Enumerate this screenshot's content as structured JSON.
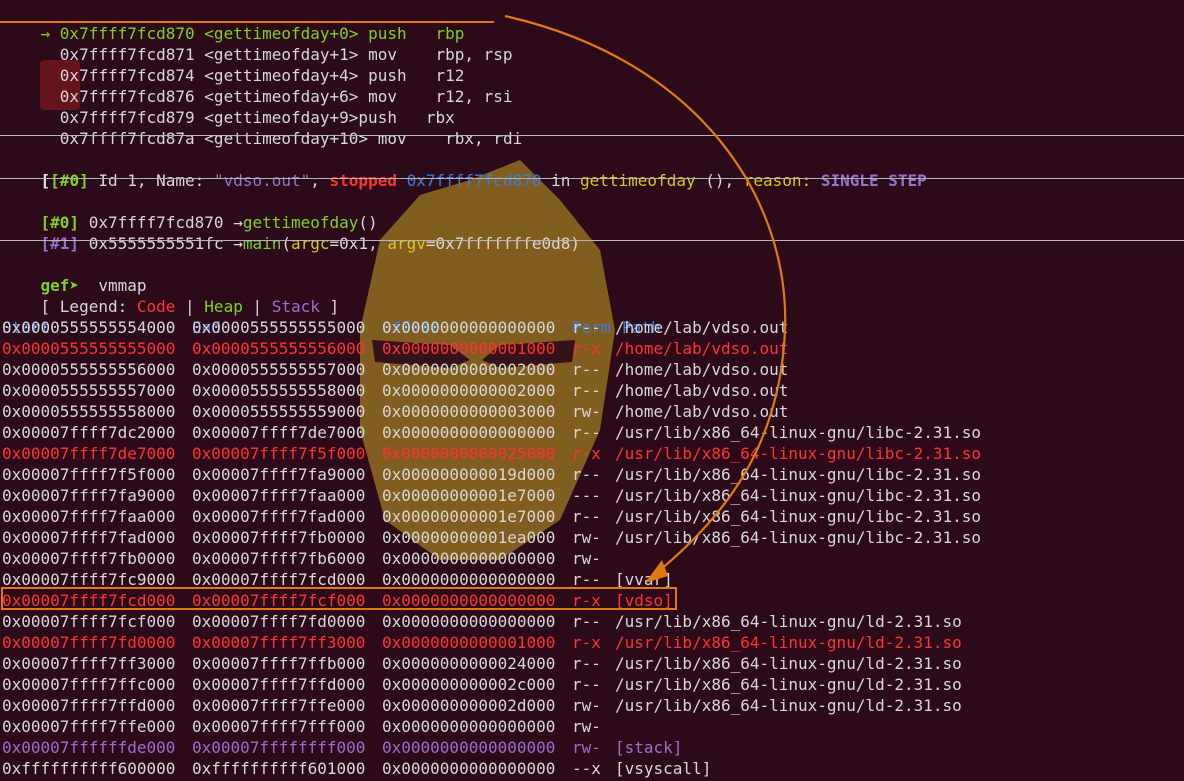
{
  "disasm": [
    {
      "arrow": "→ ",
      "addr": "0x7ffff7fcd870",
      "sym": "<gettimeofday+0>",
      "pad": " ",
      "mnem": "push",
      "gap": "   ",
      "ops": "rbp",
      "current": true
    },
    {
      "arrow": "  ",
      "addr": "0x7ffff7fcd871",
      "sym": "<gettimeofday+1>",
      "pad": " ",
      "mnem": "mov",
      "gap": "    ",
      "ops": "rbp, rsp",
      "current": false
    },
    {
      "arrow": "  ",
      "addr": "0x7ffff7fcd874",
      "sym": "<gettimeofday+4>",
      "pad": " ",
      "mnem": "push",
      "gap": "   ",
      "ops": "r12",
      "current": false
    },
    {
      "arrow": "  ",
      "addr": "0x7ffff7fcd876",
      "sym": "<gettimeofday+6>",
      "pad": " ",
      "mnem": "mov",
      "gap": "    ",
      "ops": "r12, rsi",
      "current": false
    },
    {
      "arrow": "  ",
      "addr": "0x7ffff7fcd879",
      "sym": "<gettimeofday+9>",
      "pad": "",
      "mnem": "push",
      "gap": "   ",
      "ops": "rbx",
      "current": false
    },
    {
      "arrow": "  ",
      "addr": "0x7ffff7fcd87a",
      "sym": "<gettimeofday+10>",
      "pad": " ",
      "mnem": "mov",
      "gap": "    ",
      "ops": "rbx, rdi",
      "current": false
    }
  ],
  "thread": {
    "index": "[#0]",
    "text1": " Id 1, Name: ",
    "name": "\"vdso.out\"",
    "comma": ", ",
    "stopped": "stopped",
    "addr": "0x7ffff7fcd870",
    "in": " in ",
    "func": "gettimeofday",
    "rest": " (), ",
    "reason_label": "reason:",
    "reason": "SINGLE STEP"
  },
  "trace": [
    {
      "index": "[#0]",
      "addr": " 0x7ffff7fcd870 ",
      "arrow": "→",
      "func": "gettimeofday",
      "args": "()"
    },
    {
      "index": "[#1]",
      "addr": " 0x5555555551fc ",
      "arrow": "→",
      "func": "main",
      "open": "(",
      "a1": "argc",
      "v1": "=0x1, ",
      "a2": "argv",
      "v2": "=0x7fffffffe0d8)"
    }
  ],
  "prompt": {
    "text": "gef➤",
    "command": "  vmmap"
  },
  "legend": {
    "open": "[ Legend: ",
    "code": "Code",
    "sep": " | ",
    "heap": "Heap",
    "stack": "Stack",
    "close": " ]"
  },
  "headers": {
    "start": "Start",
    "end": "End",
    "offset": "Offset",
    "perm": "Perm",
    "path": "Path"
  },
  "vmmap": [
    {
      "start": "0x0000555555554000",
      "end": "0x0000555555555000",
      "offset": "0x0000000000000000",
      "perm": "r--",
      "path": "/home/lab/vdso.out",
      "type": "normal"
    },
    {
      "start": "0x0000555555555000",
      "end": "0x0000555555556000",
      "offset": "0x0000000000001000",
      "perm": "r-x",
      "path": "/home/lab/vdso.out",
      "type": "code"
    },
    {
      "start": "0x0000555555556000",
      "end": "0x0000555555557000",
      "offset": "0x0000000000002000",
      "perm": "r--",
      "path": "/home/lab/vdso.out",
      "type": "normal"
    },
    {
      "start": "0x0000555555557000",
      "end": "0x0000555555558000",
      "offset": "0x0000000000002000",
      "perm": "r--",
      "path": "/home/lab/vdso.out",
      "type": "normal"
    },
    {
      "start": "0x0000555555558000",
      "end": "0x0000555555559000",
      "offset": "0x0000000000003000",
      "perm": "rw-",
      "path": "/home/lab/vdso.out",
      "type": "normal"
    },
    {
      "start": "0x00007ffff7dc2000",
      "end": "0x00007ffff7de7000",
      "offset": "0x0000000000000000",
      "perm": "r--",
      "path": "/usr/lib/x86_64-linux-gnu/libc-2.31.so",
      "type": "normal"
    },
    {
      "start": "0x00007ffff7de7000",
      "end": "0x00007ffff7f5f000",
      "offset": "0x0000000000025000",
      "perm": "r-x",
      "path": "/usr/lib/x86_64-linux-gnu/libc-2.31.so",
      "type": "code"
    },
    {
      "start": "0x00007ffff7f5f000",
      "end": "0x00007ffff7fa9000",
      "offset": "0x000000000019d000",
      "perm": "r--",
      "path": "/usr/lib/x86_64-linux-gnu/libc-2.31.so",
      "type": "normal"
    },
    {
      "start": "0x00007ffff7fa9000",
      "end": "0x00007ffff7faa000",
      "offset": "0x00000000001e7000",
      "perm": "---",
      "path": "/usr/lib/x86_64-linux-gnu/libc-2.31.so",
      "type": "normal"
    },
    {
      "start": "0x00007ffff7faa000",
      "end": "0x00007ffff7fad000",
      "offset": "0x00000000001e7000",
      "perm": "r--",
      "path": "/usr/lib/x86_64-linux-gnu/libc-2.31.so",
      "type": "normal"
    },
    {
      "start": "0x00007ffff7fad000",
      "end": "0x00007ffff7fb0000",
      "offset": "0x00000000001ea000",
      "perm": "rw-",
      "path": "/usr/lib/x86_64-linux-gnu/libc-2.31.so",
      "type": "normal"
    },
    {
      "start": "0x00007ffff7fb0000",
      "end": "0x00007ffff7fb6000",
      "offset": "0x0000000000000000",
      "perm": "rw-",
      "path": "",
      "type": "normal"
    },
    {
      "start": "0x00007ffff7fc9000",
      "end": "0x00007ffff7fcd000",
      "offset": "0x0000000000000000",
      "perm": "r--",
      "path": "[vvar]",
      "type": "normal"
    },
    {
      "start": "0x00007ffff7fcd000",
      "end": "0x00007ffff7fcf000",
      "offset": "0x0000000000000000",
      "perm": "r-x",
      "path": "[vdso]",
      "type": "code"
    },
    {
      "start": "0x00007ffff7fcf000",
      "end": "0x00007ffff7fd0000",
      "offset": "0x0000000000000000",
      "perm": "r--",
      "path": "/usr/lib/x86_64-linux-gnu/ld-2.31.so",
      "type": "normal"
    },
    {
      "start": "0x00007ffff7fd0000",
      "end": "0x00007ffff7ff3000",
      "offset": "0x0000000000001000",
      "perm": "r-x",
      "path": "/usr/lib/x86_64-linux-gnu/ld-2.31.so",
      "type": "code"
    },
    {
      "start": "0x00007ffff7ff3000",
      "end": "0x00007ffff7ffb000",
      "offset": "0x0000000000024000",
      "perm": "r--",
      "path": "/usr/lib/x86_64-linux-gnu/ld-2.31.so",
      "type": "normal"
    },
    {
      "start": "0x00007ffff7ffc000",
      "end": "0x00007ffff7ffd000",
      "offset": "0x000000000002c000",
      "perm": "r--",
      "path": "/usr/lib/x86_64-linux-gnu/ld-2.31.so",
      "type": "normal"
    },
    {
      "start": "0x00007ffff7ffd000",
      "end": "0x00007ffff7ffe000",
      "offset": "0x000000000002d000",
      "perm": "rw-",
      "path": "/usr/lib/x86_64-linux-gnu/ld-2.31.so",
      "type": "normal"
    },
    {
      "start": "0x00007ffff7ffe000",
      "end": "0x00007ffff7fff000",
      "offset": "0x0000000000000000",
      "perm": "rw-",
      "path": "",
      "type": "normal"
    },
    {
      "start": "0x00007ffffffde000",
      "end": "0x00007ffffffff000",
      "offset": "0x0000000000000000",
      "perm": "rw-",
      "path": "[stack]",
      "type": "stack"
    },
    {
      "start": "0xffffffffff600000",
      "end": "0xffffffffff601000",
      "offset": "0x0000000000000000",
      "perm": "--x",
      "path": "[vsyscall]",
      "type": "normal"
    }
  ],
  "colors": {
    "background": "#2c0a1a",
    "code": "#ff3333",
    "heap": "#7ed321",
    "stack": "#9b6fcf",
    "header": "#3b7ddd",
    "annotation": "#e07a10"
  },
  "icons": {
    "prompt_arrow": "gef-prompt-arrow",
    "trace_arrow": "right-arrow"
  }
}
